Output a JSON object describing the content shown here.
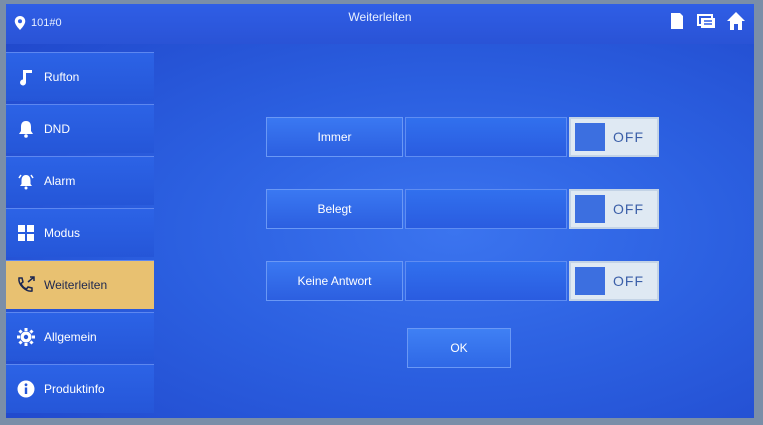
{
  "header": {
    "room": "101#0",
    "title": "Weiterleiten"
  },
  "sidebar": {
    "items": [
      {
        "label": "Rufton",
        "icon": "music-note-icon"
      },
      {
        "label": "DND",
        "icon": "bell-icon"
      },
      {
        "label": "Alarm",
        "icon": "alarm-icon"
      },
      {
        "label": "Modus",
        "icon": "grid-icon"
      },
      {
        "label": "Weiterleiten",
        "icon": "phone-forward-icon",
        "active": true
      },
      {
        "label": "Allgemein",
        "icon": "gear-icon"
      },
      {
        "label": "Produktinfo",
        "icon": "info-icon"
      }
    ]
  },
  "forwarding": {
    "rows": [
      {
        "label": "Immer",
        "state": "OFF"
      },
      {
        "label": "Belegt",
        "state": "OFF"
      },
      {
        "label": "Keine Antwort",
        "state": "OFF"
      }
    ]
  },
  "ok_label": "OK",
  "colors": {
    "background": "#2b5fe0",
    "active_item": "#e8c171",
    "toggle_bg": "#dfe9f3",
    "toggle_knob": "#3c6fe0"
  }
}
